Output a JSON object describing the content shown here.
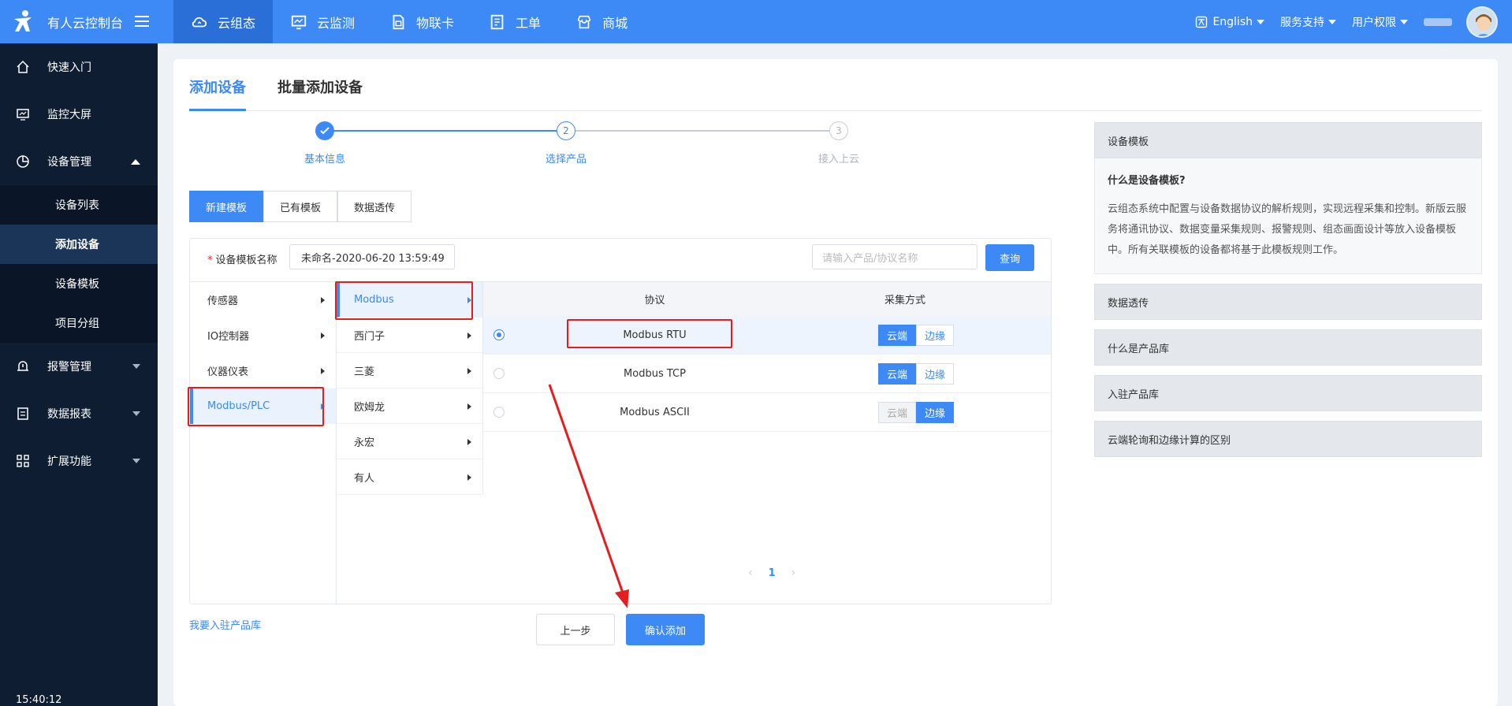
{
  "header": {
    "brand": "有人云控制台",
    "nav": [
      {
        "label": "云组态",
        "icon": "cloud-icon"
      },
      {
        "label": "云监测",
        "icon": "monitor-chart-icon"
      },
      {
        "label": "物联卡",
        "icon": "sim-card-icon"
      },
      {
        "label": "工单",
        "icon": "document-icon"
      },
      {
        "label": "商城",
        "icon": "store-icon"
      }
    ],
    "language": "English",
    "support": "服务支持",
    "permissions": "用户权限"
  },
  "sidebar": {
    "items": [
      {
        "label": "快速入门",
        "icon": "home-icon"
      },
      {
        "label": "监控大屏",
        "icon": "screen-icon"
      },
      {
        "label": "设备管理",
        "icon": "device-icon"
      },
      {
        "label": "报警管理",
        "icon": "alarm-icon"
      },
      {
        "label": "数据报表",
        "icon": "report-icon"
      },
      {
        "label": "扩展功能",
        "icon": "grid-icon"
      }
    ],
    "submenu": [
      "设备列表",
      "添加设备",
      "设备模板",
      "项目分组"
    ],
    "clock": "15:40:12"
  },
  "tabs": [
    "添加设备",
    "批量添加设备"
  ],
  "steps": [
    {
      "label": "基本信息",
      "status": "done"
    },
    {
      "num": "2",
      "label": "选择产品",
      "status": "active"
    },
    {
      "num": "3",
      "label": "接入上云",
      "status": "pending"
    }
  ],
  "template_tabs": [
    "新建模板",
    "已有模板",
    "数据透传"
  ],
  "form": {
    "name_label": "设备模板名称",
    "name_value": "未命名-2020-06-20 13:59:49",
    "search_placeholder": "请输入产品/协议名称",
    "query_button": "查询"
  },
  "categories": [
    "传感器",
    "IO控制器",
    "仪器仪表",
    "Modbus/PLC"
  ],
  "brands": [
    "Modbus",
    "西门子",
    "三菱",
    "欧姆龙",
    "永宏",
    "有人"
  ],
  "table": {
    "headers": [
      "协议",
      "采集方式"
    ],
    "rows": [
      {
        "protocol": "Modbus RTU",
        "selected": true,
        "cloud": "云端",
        "edge": "边缘",
        "mode": "cloud"
      },
      {
        "protocol": "Modbus TCP",
        "selected": false,
        "cloud": "云端",
        "edge": "边缘",
        "mode": "cloud"
      },
      {
        "protocol": "Modbus ASCII",
        "selected": false,
        "cloud": "云端",
        "edge": "边缘",
        "mode": "edge"
      }
    ],
    "page": "1"
  },
  "footer": {
    "join_link": "我要入驻产品库",
    "prev": "上一步",
    "confirm": "确认添加"
  },
  "help": {
    "title": "设备模板",
    "question": "什么是设备模板?",
    "answer": "云组态系统中配置与设备数据协议的解析规则，实现远程采集和控制。新版云服务将通讯协议、数据变量采集规则、报警规则、组态画面设计等放入设备模板中。所有关联模板的设备都将基于此模板规则工作。",
    "sections": [
      "数据透传",
      "什么是产品库",
      "入驻产品库",
      "云端轮询和边缘计算的区别"
    ]
  },
  "colors": {
    "primary": "#3d8af7",
    "sidebar": "#0f1d33",
    "highlight": "#e51d1d"
  }
}
